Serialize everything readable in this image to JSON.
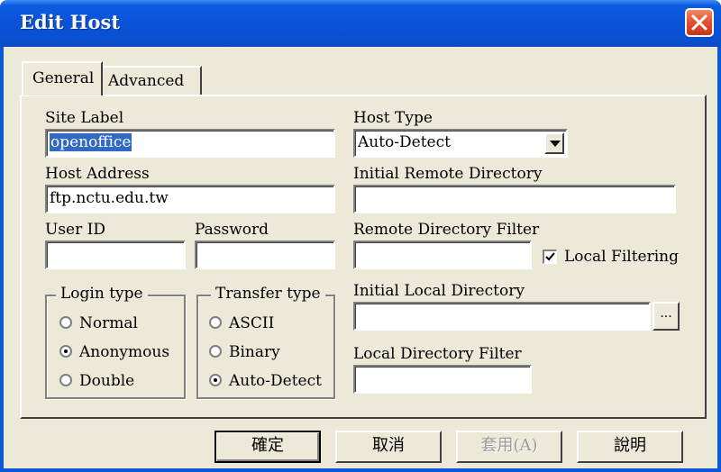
{
  "window": {
    "title": "Edit Host"
  },
  "tabs": [
    {
      "label": "General"
    },
    {
      "label": "Advanced"
    }
  ],
  "general": {
    "site_label": {
      "label": "Site Label",
      "value": "openoffice"
    },
    "host_address": {
      "label": "Host Address",
      "value": "ftp.nctu.edu.tw"
    },
    "user_id": {
      "label": "User ID",
      "value": ""
    },
    "password": {
      "label": "Password",
      "value": ""
    },
    "login_type": {
      "title": "Login type",
      "options": [
        "Normal",
        "Anonymous",
        "Double"
      ],
      "selected": "Anonymous"
    },
    "transfer_type": {
      "title": "Transfer type",
      "options": [
        "ASCII",
        "Binary",
        "Auto-Detect"
      ],
      "selected": "Auto-Detect"
    },
    "host_type": {
      "label": "Host Type",
      "value": "Auto-Detect"
    },
    "initial_remote_directory": {
      "label": "Initial Remote Directory",
      "value": ""
    },
    "remote_directory_filter": {
      "label": "Remote Directory Filter",
      "value": ""
    },
    "local_filtering": {
      "label": "Local Filtering",
      "checked": true
    },
    "initial_local_directory": {
      "label": "Initial Local Directory",
      "value": "",
      "browse": "..."
    },
    "local_directory_filter": {
      "label": "Local Directory Filter",
      "value": ""
    }
  },
  "buttons": {
    "ok": "確定",
    "cancel": "取消",
    "apply": "套用(A)",
    "help": "說明"
  }
}
